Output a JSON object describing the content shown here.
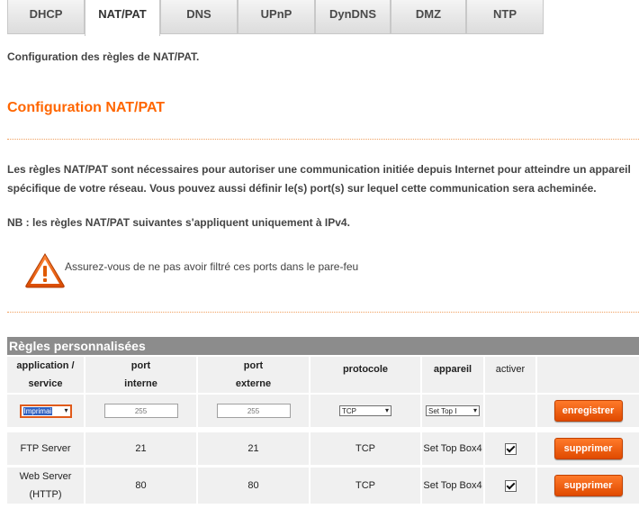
{
  "tabs": [
    {
      "label": "DHCP"
    },
    {
      "label": "NAT/PAT"
    },
    {
      "label": "DNS"
    },
    {
      "label": "UPnP"
    },
    {
      "label": "DynDNS"
    },
    {
      "label": "DMZ"
    },
    {
      "label": "NTP"
    }
  ],
  "active_tab": "NAT/PAT",
  "intro": "Configuration des règles de NAT/PAT.",
  "section_title": "Configuration NAT/PAT",
  "description": "Les règles NAT/PAT sont nécessaires pour autoriser une communication initiée depuis Internet pour atteindre un appareil spécifique de votre réseau. Vous pouvez aussi définir le(s) port(s) sur lequel cette communication sera acheminée.",
  "note": "NB : les règles NAT/PAT suivantes s'appliquent uniquement à IPv4.",
  "warning": {
    "icon": "warning-triangle-icon",
    "text": "Assurez-vous de ne pas avoir filtré ces ports dans le pare-feu"
  },
  "table": {
    "title": "Règles personnalisées",
    "headers": {
      "application": [
        "application /",
        "service"
      ],
      "port_interne": [
        "port",
        "interne"
      ],
      "port_externe": [
        "port",
        "externe"
      ],
      "protocole": "protocole",
      "appareil": "appareil",
      "activer": "activer"
    },
    "new_row": {
      "application_value": "Imprimai",
      "port_interne_placeholder": "255",
      "port_externe_placeholder": "255",
      "protocole_value": "TCP",
      "appareil_value": "Set Top I",
      "button": "enregistrer"
    },
    "rows": [
      {
        "application": "FTP Server",
        "port_interne": "21",
        "port_externe": "21",
        "protocole": "TCP",
        "appareil": "Set Top Box4",
        "activer": true,
        "button": "supprimer"
      },
      {
        "application": "Web Server (HTTP)",
        "port_interne": "80",
        "port_externe": "80",
        "protocole": "TCP",
        "appareil": "Set Top Box4",
        "activer": true,
        "button": "supprimer"
      }
    ]
  },
  "colors": {
    "accent": "#ff6600",
    "button": "#e85010",
    "table_header": "#8c8c8c",
    "cell_bg": "#f0f0f0"
  }
}
